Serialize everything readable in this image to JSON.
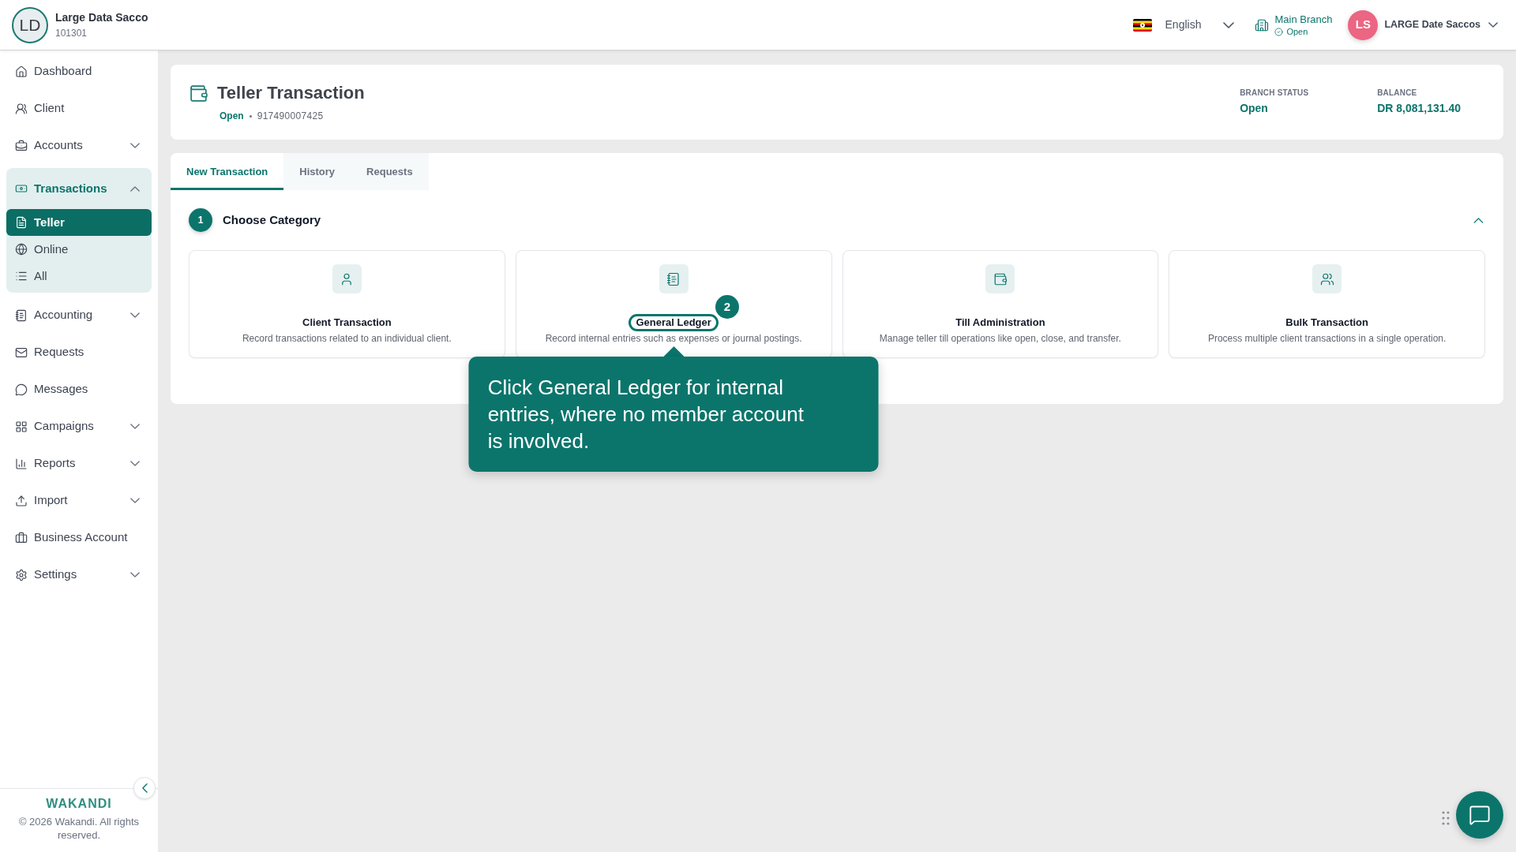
{
  "header": {
    "org": {
      "initials": "LD",
      "name": "Large Data Sacco",
      "code": "101301"
    },
    "language": "English",
    "branch": {
      "name": "Main Branch",
      "status": "Open"
    },
    "user": {
      "initials": "LS",
      "name": "LARGE Date Saccos"
    }
  },
  "sidebar": {
    "items": [
      {
        "label": "Dashboard",
        "kind": "link"
      },
      {
        "label": "Client",
        "kind": "link"
      },
      {
        "label": "Accounts",
        "kind": "group",
        "expanded": false
      },
      {
        "label": "Transactions",
        "kind": "group",
        "expanded": true,
        "children": [
          {
            "label": "Teller",
            "selected": true
          },
          {
            "label": "Online",
            "selected": false
          },
          {
            "label": "All",
            "selected": false
          }
        ]
      },
      {
        "label": "Accounting",
        "kind": "group",
        "expanded": false
      },
      {
        "label": "Requests",
        "kind": "link"
      },
      {
        "label": "Messages",
        "kind": "link"
      },
      {
        "label": "Campaigns",
        "kind": "group",
        "expanded": false
      },
      {
        "label": "Reports",
        "kind": "group",
        "expanded": false
      },
      {
        "label": "Import",
        "kind": "group",
        "expanded": false
      },
      {
        "label": "Business Account",
        "kind": "link"
      },
      {
        "label": "Settings",
        "kind": "group",
        "expanded": false
      }
    ],
    "brand": "WAKANDI",
    "copyright": "© 2026 Wakandi. All rights reserved."
  },
  "page_header": {
    "title": "Teller Transaction",
    "status": "Open",
    "teller_id": "917490007425",
    "stats": [
      {
        "label": "BRANCH STATUS",
        "value": "Open"
      },
      {
        "label": "BALANCE",
        "value": "DR 8,081,131.40"
      }
    ]
  },
  "tabs": [
    {
      "label": "New Transaction",
      "selected": true
    },
    {
      "label": "History",
      "selected": false
    },
    {
      "label": "Requests",
      "selected": false
    }
  ],
  "step": {
    "number": "1",
    "title": "Choose Category",
    "expanded": true
  },
  "categories": [
    {
      "title": "Client Transaction",
      "description": "Record transactions related to an individual client.",
      "highlighted": false
    },
    {
      "title": "General Ledger",
      "description": "Record internal entries such as expenses or journal postings.",
      "highlighted": true
    },
    {
      "title": "Till Administration",
      "description": "Manage teller till operations like open, close, and transfer.",
      "highlighted": false
    },
    {
      "title": "Bulk Transaction",
      "description": "Process multiple client transactions in a single operation.",
      "highlighted": false
    }
  ],
  "tour": {
    "step": "2",
    "text": "Click General Ledger for internal entries, where no member account is involved."
  }
}
